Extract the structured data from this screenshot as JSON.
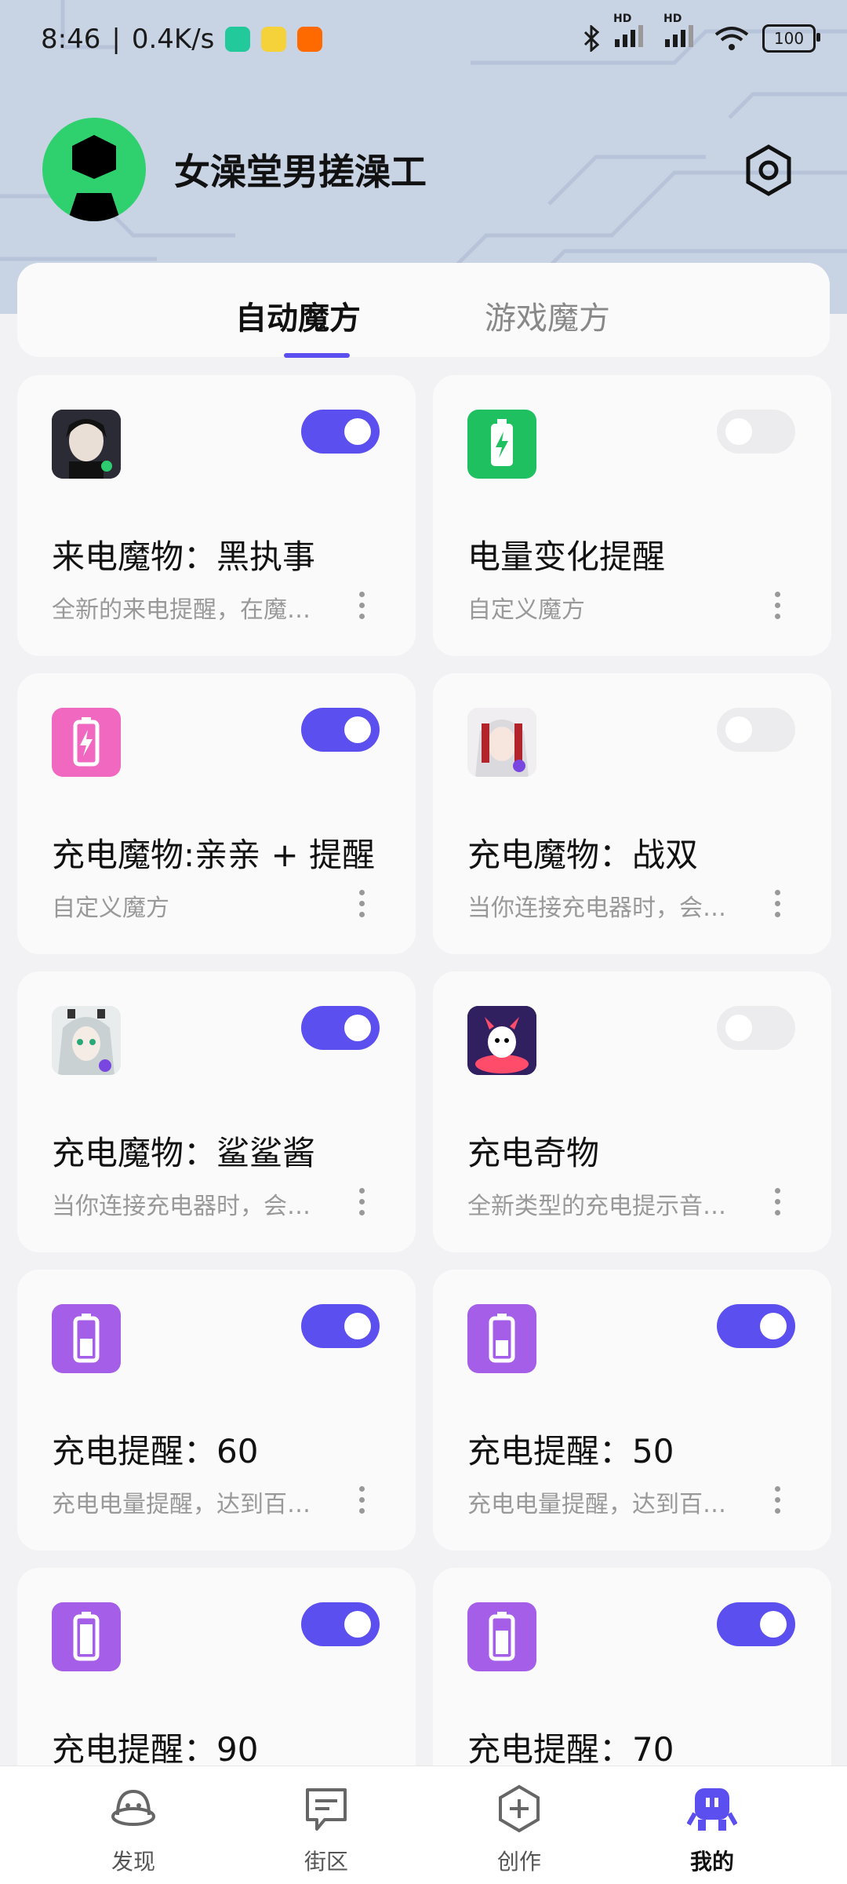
{
  "status": {
    "time": "8:46",
    "speed": "0.4K/s",
    "battery": "100",
    "net_label_1": "HD",
    "net_label_2": "HD"
  },
  "profile": {
    "username": "女澡堂男搓澡工"
  },
  "tabs": [
    {
      "label": "自动魔方",
      "active": true
    },
    {
      "label": "游戏魔方",
      "active": false
    }
  ],
  "cards": [
    {
      "title": "来电魔物：黑执事",
      "desc": "全新的来电提醒，在魔…",
      "on": true
    },
    {
      "title": "电量变化提醒",
      "desc": "自定义魔方",
      "on": false
    },
    {
      "title": "充电魔物:亲亲 + 提醒",
      "desc": "自定义魔方",
      "on": true
    },
    {
      "title": "充电魔物：战双",
      "desc": "当你连接充电器时，会…",
      "on": false
    },
    {
      "title": "充电魔物：鲨鲨酱",
      "desc": "当你连接充电器时，会…",
      "on": true
    },
    {
      "title": "充电奇物",
      "desc": "全新类型的充电提示音…",
      "on": false
    },
    {
      "title": "充电提醒：60",
      "desc": "充电电量提醒，达到百…",
      "on": true
    },
    {
      "title": "充电提醒：50",
      "desc": "充电电量提醒，达到百…",
      "on": true
    },
    {
      "title": "充电提醒：90",
      "desc": "",
      "on": true
    },
    {
      "title": "充电提醒：70",
      "desc": "",
      "on": true
    }
  ],
  "nav": [
    {
      "label": "发现",
      "icon": "ufo-icon"
    },
    {
      "label": "街区",
      "icon": "chat-icon"
    },
    {
      "label": "创作",
      "icon": "create-icon"
    },
    {
      "label": "我的",
      "icon": "robot-icon",
      "active": true
    }
  ],
  "colors": {
    "accent": "#5c4ff0",
    "header_bg": "#c8d3e4",
    "avatar_bg": "#2ed16e"
  }
}
